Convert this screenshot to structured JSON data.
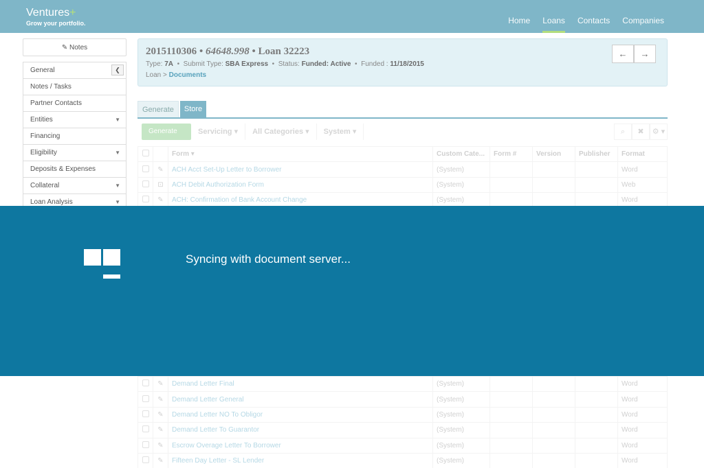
{
  "brand": {
    "name": "Ventures",
    "plus": "+",
    "tagline": "Grow your portfolio."
  },
  "nav": {
    "items": [
      "Home",
      "Loans",
      "Contacts",
      "Companies"
    ],
    "active": "Loans"
  },
  "sidebar": {
    "notes_label": "Notes",
    "items": [
      {
        "label": "General",
        "type": "collapse"
      },
      {
        "label": "Notes / Tasks",
        "type": "none"
      },
      {
        "label": "Partner Contacts",
        "type": "none"
      },
      {
        "label": "Entities",
        "type": "caret"
      },
      {
        "label": "Financing",
        "type": "none"
      },
      {
        "label": "Eligibility",
        "type": "caret"
      },
      {
        "label": "Deposits & Expenses",
        "type": "none"
      },
      {
        "label": "Collateral",
        "type": "caret"
      },
      {
        "label": "Loan Analysis",
        "type": "caret"
      }
    ]
  },
  "loan": {
    "number": "2015110306",
    "amount": "64648.998",
    "name": "Loan 32223",
    "type_label": "Type:",
    "type_value": "7A",
    "submit_label": "Submit Type:",
    "submit_value": "SBA Express",
    "status_label": "Status:",
    "status_value": "Funded: Active",
    "funded_label": "Funded :",
    "funded_value": "11/18/2015",
    "crumb_root": "Loan",
    "crumb_sep": ">",
    "crumb_current": "Documents",
    "prev_icon": "←",
    "next_icon": "→"
  },
  "tabs": {
    "generate": "Generate",
    "store": "Store"
  },
  "toolbar": {
    "primary": "Generate",
    "servicing": "Servicing ▾",
    "categories": "All Categories ▾",
    "system": "System ▾",
    "search_icon": "⌕",
    "clear_icon": "✖",
    "settings_icon": "⚙ ▾"
  },
  "table": {
    "headers": [
      "Form ▾",
      "Custom Cate...",
      "Form #",
      "Version",
      "Publisher",
      "Format"
    ],
    "rows_top": [
      {
        "action": "✎",
        "form": "ACH Acct Set-Up Letter to Borrower",
        "cat": "(System)",
        "fmt": "Word"
      },
      {
        "action": "⊡",
        "form": "ACH Debit Authorization Form",
        "cat": "(System)",
        "fmt": "Web"
      },
      {
        "action": "✎",
        "form": "ACH: Confirmation of Bank Account Change",
        "cat": "(System)",
        "fmt": "Word"
      }
    ],
    "rows_bottom": [
      {
        "action": "✎",
        "form": "Demand Letter Final",
        "cat": "(System)",
        "fmt": "Word"
      },
      {
        "action": "✎",
        "form": "Demand Letter General",
        "cat": "(System)",
        "fmt": "Word"
      },
      {
        "action": "✎",
        "form": "Demand Letter NO To Obligor",
        "cat": "(System)",
        "fmt": "Word"
      },
      {
        "action": "✎",
        "form": "Demand Letter To Guarantor",
        "cat": "(System)",
        "fmt": "Word"
      },
      {
        "action": "✎",
        "form": "Escrow Overage Letter To Borrower",
        "cat": "(System)",
        "fmt": "Word"
      },
      {
        "action": "✎",
        "form": "Fifteen Day Letter - SL Lender",
        "cat": "(System)",
        "fmt": "Word"
      }
    ]
  },
  "overlay": {
    "message": "Syncing with document server...",
    "icon": "loading-squares-icon"
  },
  "colors": {
    "header": "#7fb6c8",
    "accent": "#b5e07a",
    "overlay": "#0e77a0",
    "link": "#2a8fb5"
  }
}
